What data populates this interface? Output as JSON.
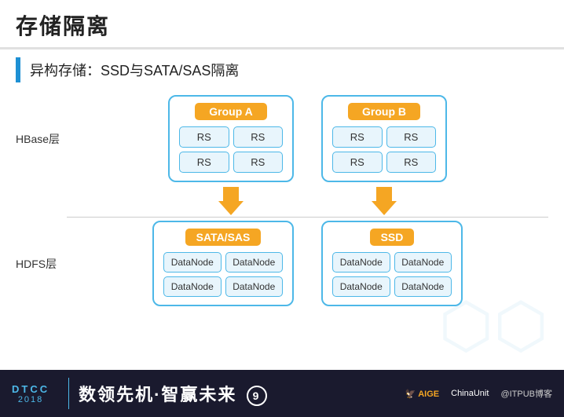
{
  "header": {
    "title": "存储隔离"
  },
  "subtitle": {
    "text": "异构存储：SSD与SATA/SAS隔离"
  },
  "layers": {
    "hbase": "HBase层",
    "hdfs": "HDFS层"
  },
  "groupA": {
    "label": "Group A",
    "rs_cells": [
      "RS",
      "RS",
      "RS",
      "RS"
    ]
  },
  "groupB": {
    "label": "Group B",
    "rs_cells": [
      "RS",
      "RS",
      "RS",
      "RS"
    ]
  },
  "storageA": {
    "label": "SATA/SAS",
    "dn_cells": [
      "DataNode",
      "DataNode",
      "DataNode",
      "DataNode"
    ]
  },
  "storageB": {
    "label": "SSD",
    "dn_cells": [
      "DataNode",
      "DataNode",
      "DataNode",
      "DataNode"
    ]
  },
  "footer": {
    "dtcc_top": "DTCC",
    "dtcc_bottom": "2018",
    "slogan": "数领先机·智赢未来",
    "slogan_icon": "⑨",
    "logos": [
      "AIGE",
      "ChinaUnit",
      "ITPUB博客"
    ]
  }
}
